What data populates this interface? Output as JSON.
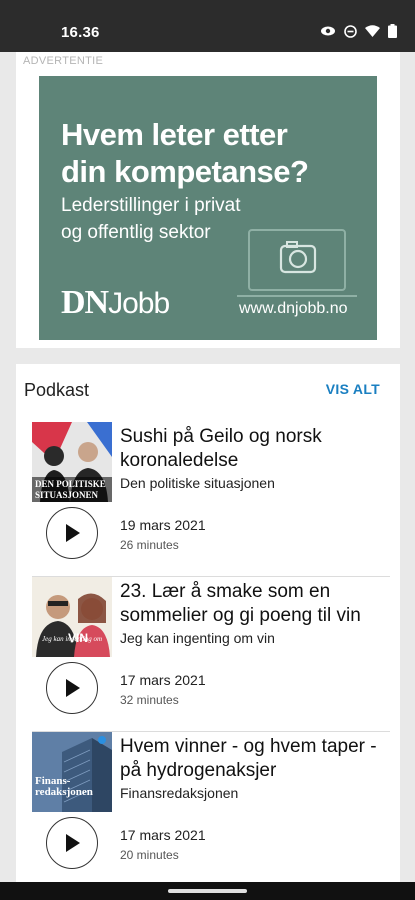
{
  "status_bar": {
    "time": "16.36",
    "icons": [
      "eye-icon",
      "do-not-disturb-icon",
      "wifi-icon",
      "battery-icon"
    ]
  },
  "ad": {
    "label": "ADVERTENTIE",
    "headline_line1": "Hvem leter etter",
    "headline_line2": "din kompetanse?",
    "sub_line1": "Lederstillinger i privat",
    "sub_line2": "og offentlig sektor",
    "logo_dn": "DN",
    "logo_jobb": "Jobb",
    "url": "www.dnjobb.no",
    "background": "#5e8478"
  },
  "podcasts": {
    "title": "Podkast",
    "view_all": "VIS ALT",
    "accent": "#1a7fc1",
    "episodes": [
      {
        "title": "Sushi på Geilo og norsk koronaledelse",
        "show": "Den politiske situasjonen",
        "date": "19 mars 2021",
        "duration": "26 minutes",
        "thumb_text_1": "DEN POLITISKE",
        "thumb_text_2": "SITUASJONEN"
      },
      {
        "title": "23. Lær å smake som en sommelier og gi poeng til vin",
        "show": "Jeg kan ingenting om vin",
        "date": "17 mars 2021",
        "duration": "32 minutes",
        "thumb_text_1": "VIN"
      },
      {
        "title": "Hvem vinner - og hvem taper - på  hydrogenaksjer",
        "show": "Finansredaksjonen",
        "date": "17 mars 2021",
        "duration": "20 minutes",
        "thumb_text_1": "Finans-",
        "thumb_text_2": "redaksjonen"
      }
    ]
  }
}
